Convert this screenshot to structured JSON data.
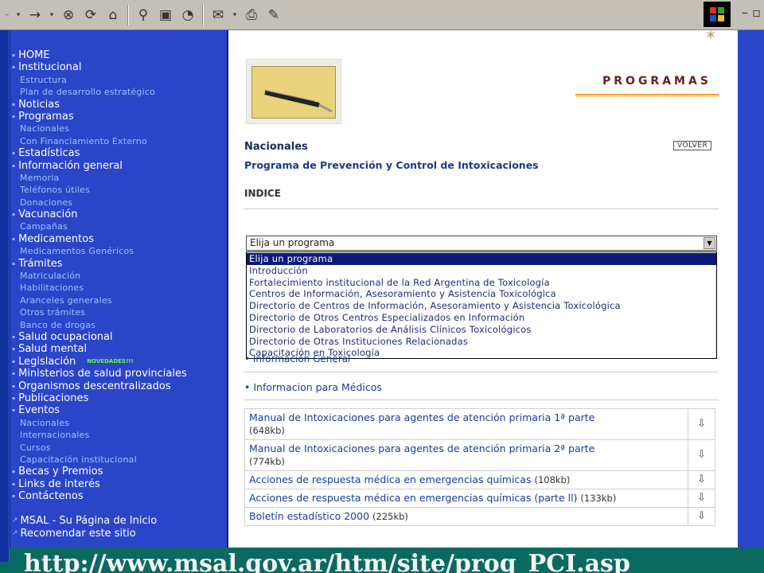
{
  "sidebar": {
    "items": [
      {
        "label": "HOME",
        "level": "main"
      },
      {
        "label": "Institucional",
        "level": "main"
      },
      {
        "label": "Estructura",
        "level": "sub"
      },
      {
        "label": "Plan de desarrollo estratégico",
        "level": "sub"
      },
      {
        "label": "Noticias",
        "level": "main"
      },
      {
        "label": "Programas",
        "level": "main"
      },
      {
        "label": "Nacionales",
        "level": "sub"
      },
      {
        "label": "Con Financiamiento Externo",
        "level": "sub"
      },
      {
        "label": "Estadísticas",
        "level": "main"
      },
      {
        "label": "Información general",
        "level": "main"
      },
      {
        "label": "Memoria",
        "level": "sub"
      },
      {
        "label": "Teléfonos útiles",
        "level": "sub"
      },
      {
        "label": "Donaciones",
        "level": "sub"
      },
      {
        "label": "Vacunación",
        "level": "main"
      },
      {
        "label": "Campañas",
        "level": "sub"
      },
      {
        "label": "Medicamentos",
        "level": "main"
      },
      {
        "label": "Medicamentos Genéricos",
        "level": "sub"
      },
      {
        "label": "Trámites",
        "level": "main"
      },
      {
        "label": "Matriculación",
        "level": "sub"
      },
      {
        "label": "Habilitaciones",
        "level": "sub"
      },
      {
        "label": "Aranceles generales",
        "level": "sub"
      },
      {
        "label": "Otros trámites",
        "level": "sub"
      },
      {
        "label": "Banco de drogas",
        "level": "sub"
      },
      {
        "label": "Salud ocupacional",
        "level": "main"
      },
      {
        "label": "Salud mental",
        "level": "main"
      },
      {
        "label": "Legislación",
        "level": "main",
        "badge": "NOVEDADES!!!"
      },
      {
        "label": "Ministerios de salud provinciales",
        "level": "main"
      },
      {
        "label": "Organismos descentralizados",
        "level": "main"
      },
      {
        "label": "Publicaciones",
        "level": "main"
      },
      {
        "label": "Eventos",
        "level": "main"
      },
      {
        "label": "Nacionales",
        "level": "sub"
      },
      {
        "label": "Internacionales",
        "level": "sub"
      },
      {
        "label": "Cursos",
        "level": "sub"
      },
      {
        "label": "Capacitación institucional",
        "level": "sub"
      },
      {
        "label": "Becas y Premios",
        "level": "main"
      },
      {
        "label": "Links de interés",
        "level": "main"
      },
      {
        "label": "Contáctenos",
        "level": "main"
      }
    ],
    "footer_links": [
      {
        "label": "MSAL - Su Página de Inicio"
      },
      {
        "label": "Recomendar este sitio"
      }
    ]
  },
  "banner": {
    "title": "PROGRAMAS"
  },
  "section": {
    "title": "Nacionales",
    "back_label": "VOLVER",
    "program_name": "Programa de Prevención y Control de Intoxicaciones",
    "index_label": "INDICE"
  },
  "select": {
    "value": "Elija un programa",
    "options": [
      "Elija un programa",
      "Introducción",
      "Fortalecimiento institucional de la Red Argentina de Toxicología",
      "Centros de Información, Asesoramiento y Asistencia Toxicológica",
      "Directorio de Centros de Información, Asesoramiento y Asistencia Toxicológica",
      "Directorio de Otros Centros Especializados en Información",
      "Directorio de Laboratorios de Análisis Clínicos Toxicológicos",
      "Directorio de Otras Instituciones Relacionadas",
      "Capacitación en Toxicología"
    ]
  },
  "links": {
    "info_general": "• Información General",
    "info_medicos": "• Informacion para Médicos"
  },
  "documents": [
    {
      "title": "Manual de Intoxicaciones para agentes de atención primaria 1ª parte",
      "size": "(648kb)"
    },
    {
      "title": "Manual de Intoxicaciones para agentes de atención primaria 2ª parte",
      "size": "(774kb)"
    },
    {
      "title": "Acciones de respuesta médica en emergencias químicas",
      "size": "(108kb)"
    },
    {
      "title": "Acciones de respuesta médica en emergencias químicas (parte ll)",
      "size": "(133kb)"
    },
    {
      "title": "Boletín estadístico 2000",
      "size": "(225kb)"
    }
  ],
  "url_overlay": "http://www.msal.gov.ar/htm/site/prog_PCI.asp",
  "colors": {
    "sidebar": "#2a45c8",
    "accent": "#f2a020",
    "overlay": "#0a6a62"
  }
}
